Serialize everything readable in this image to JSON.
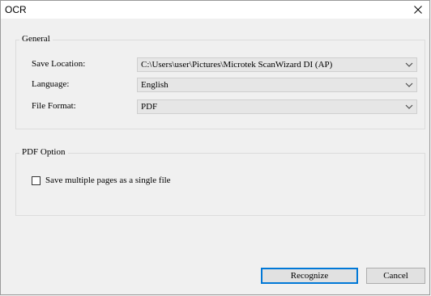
{
  "window": {
    "title": "OCR",
    "close_glyph": "✕"
  },
  "general": {
    "legend": "General",
    "save_location_label": "Save Location:",
    "save_location_value": "C:\\Users\\user\\Pictures\\Microtek ScanWizard DI (AP)",
    "language_label": "Language:",
    "language_value": "English",
    "file_format_label": "File Format:",
    "file_format_value": "PDF"
  },
  "pdf_option": {
    "legend": "PDF Option",
    "save_multiple_label": "Save multiple pages as a single file",
    "save_multiple_checked": false
  },
  "buttons": {
    "recognize": "Recognize",
    "cancel": "Cancel"
  },
  "colors": {
    "accent": "#0078d7",
    "combo_bg": "#e6e6e6",
    "window_bg": "#f0f0f0"
  }
}
